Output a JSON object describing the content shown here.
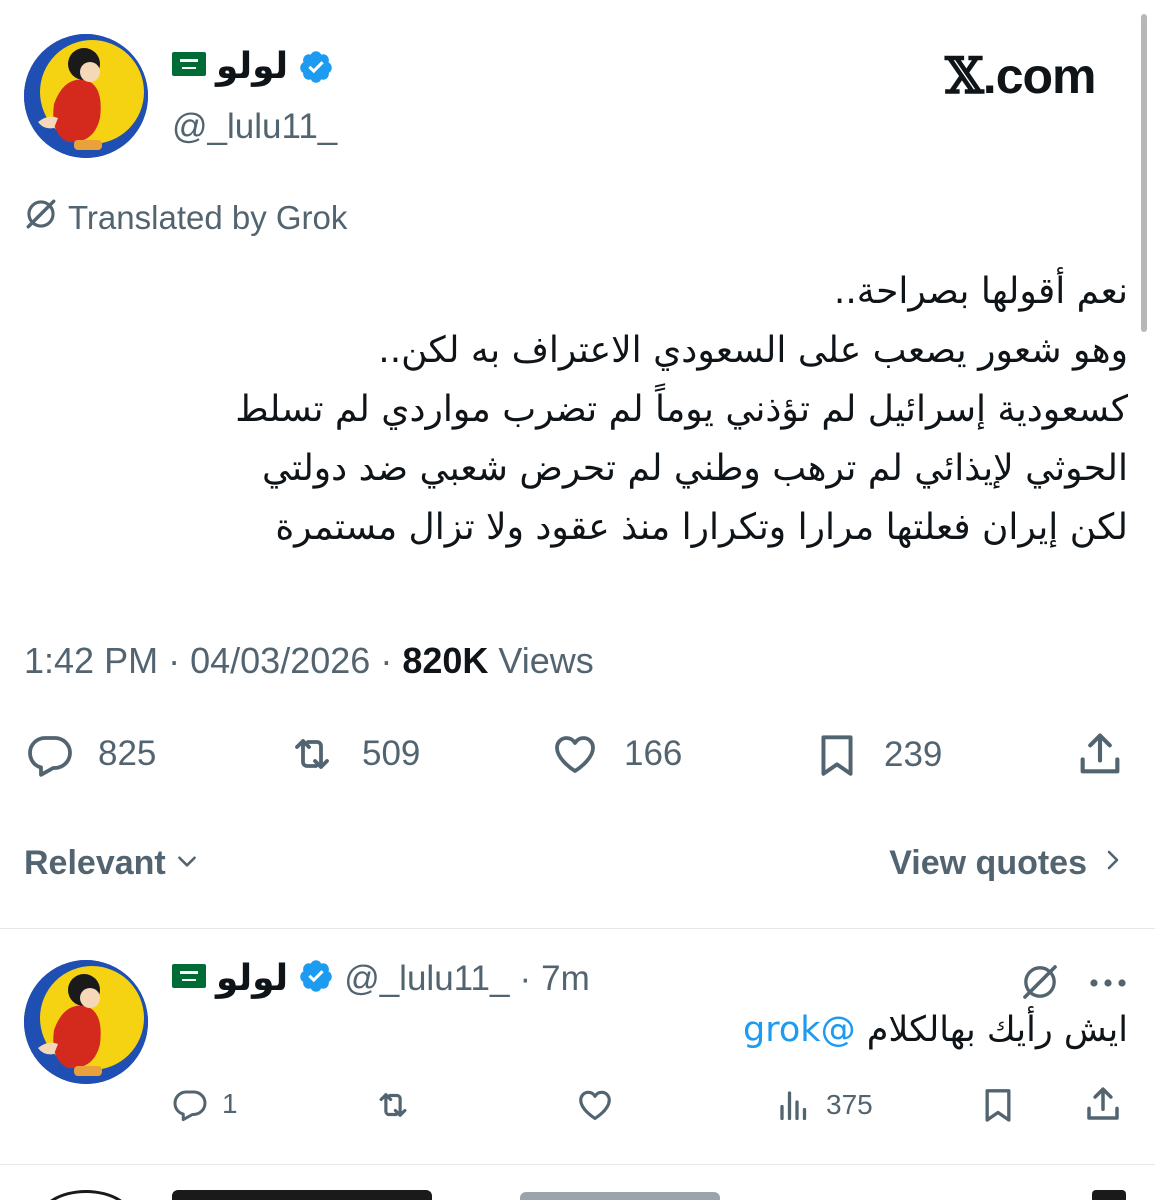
{
  "brand": {
    "text": ".com",
    "glyph": "𝕏"
  },
  "tweet": {
    "author": {
      "name": "لولو",
      "flag_icon": "saudi-flag-icon",
      "handle": "@_lulu11_",
      "verified": true
    },
    "translated_label": "Translated by Grok",
    "text_lines": [
      "نعم أقولها بصراحة..",
      "وهو شعور يصعب على السعودي الاعتراف به لكن..",
      "كسعودية إسرائيل لم تؤذني يوماً لم تضرب مواردي لم تسلط",
      "الحوثي لإيذائي لم ترهب وطني لم تحرض شعبي ضد دولتي",
      "لكن إيران فعلتها مرارا وتكرارا منذ عقود ولا تزال مستمرة"
    ],
    "time": "1:42 PM",
    "date": "04/03/2026",
    "views_count": "820K",
    "views_label": "Views",
    "separator": "·",
    "stats": {
      "replies": "825",
      "reposts": "509",
      "likes": "166",
      "bookmarks": "239"
    }
  },
  "replies_bar": {
    "sort_label": "Relevant",
    "view_quotes_label": "View quotes"
  },
  "reply": {
    "author_name": "لولو",
    "handle": "@_lulu11_",
    "separator": "·",
    "time": "7m",
    "text": "ايش رأيك بهالكلام",
    "mention": "@grok",
    "stats": {
      "replies": "1",
      "views": "375"
    }
  },
  "colors": {
    "text": "#0f1419",
    "secondary": "#536471",
    "accent": "#1d9bf0",
    "verified": "#1d9bf0",
    "flag": "#006c35"
  }
}
